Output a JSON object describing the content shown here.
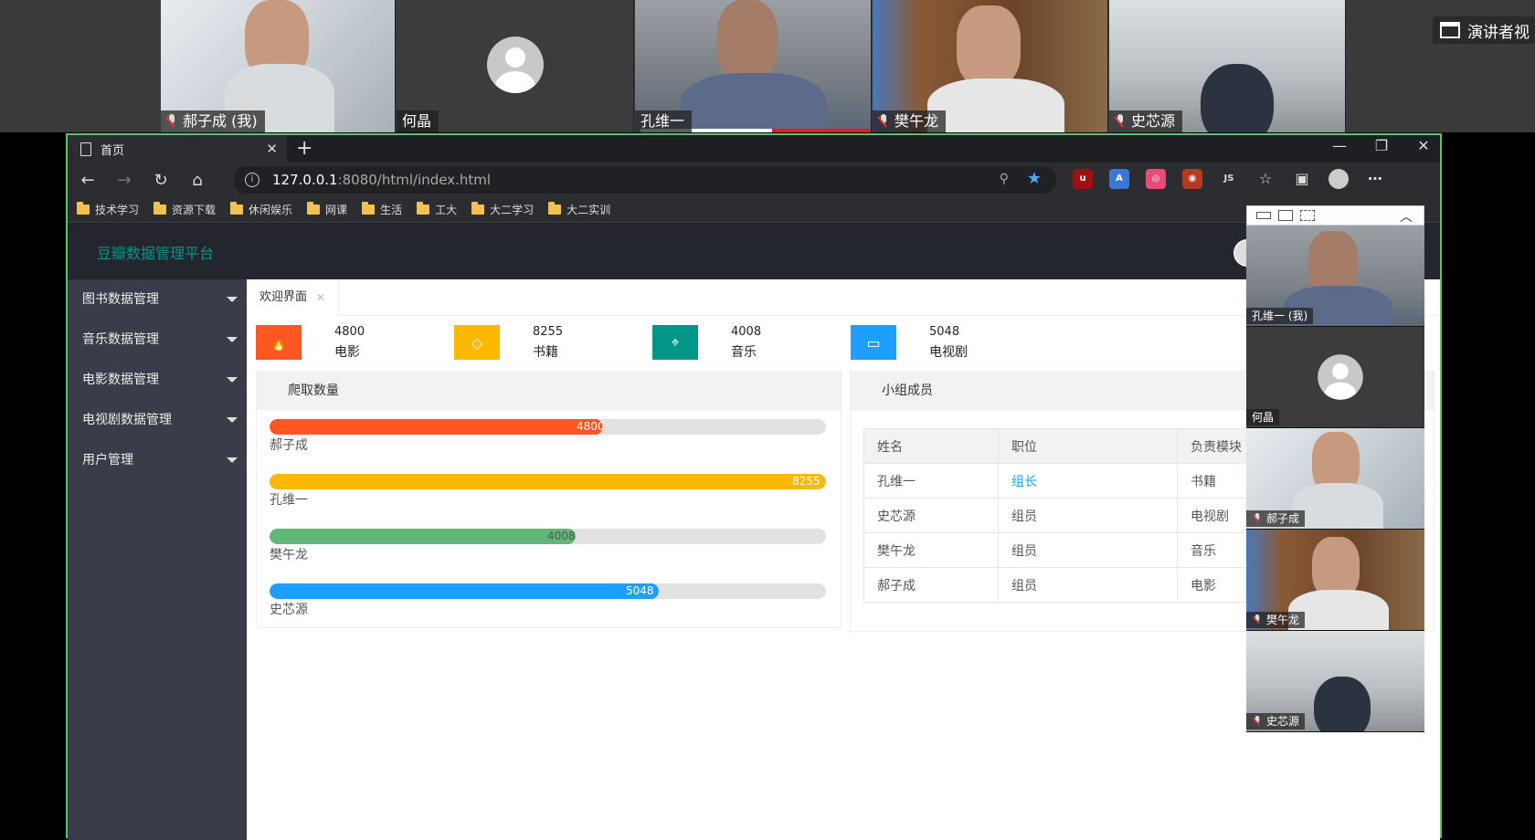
{
  "meeting": {
    "participants": [
      {
        "name": "郝子成 (我)",
        "muted": true
      },
      {
        "name": "何晶",
        "muted": false
      },
      {
        "name": "孔维一",
        "muted": false
      },
      {
        "name": "樊午龙",
        "muted": true
      },
      {
        "name": "史芯源",
        "muted": true
      }
    ],
    "speaker_view_label": "演讲者视",
    "side_participants": [
      {
        "name": "孔维一 (我)"
      },
      {
        "name": "何晶"
      },
      {
        "name": "郝子成"
      },
      {
        "name": "樊午龙"
      },
      {
        "name": "史芯源"
      }
    ]
  },
  "browser": {
    "tab_title": "首页",
    "url_host": "127.0.0.1",
    "url_rest": ":8080/html/index.html",
    "bookmarks": [
      "技术学习",
      "资源下载",
      "休闲娱乐",
      "网课",
      "生活",
      "工大",
      "大二学习",
      "大二实训"
    ]
  },
  "app": {
    "title": "豆瓣数据管理平台",
    "menu": [
      {
        "label": "图书数据管理"
      },
      {
        "label": "音乐数据管理"
      },
      {
        "label": "电影数据管理"
      },
      {
        "label": "电视剧数据管理"
      },
      {
        "label": "用户管理"
      }
    ],
    "tab_label": "欢迎界面",
    "stats": [
      {
        "value": "4800",
        "label": "电影",
        "color": "#ff5722",
        "icon": "fire-icon"
      },
      {
        "value": "8255",
        "label": "书籍",
        "color": "#ffb800",
        "icon": "diamond-icon"
      },
      {
        "value": "4008",
        "label": "音乐",
        "color": "#009688",
        "icon": "location-icon"
      },
      {
        "value": "5048",
        "label": "电视剧",
        "color": "#1e9fff",
        "icon": "tv-icon"
      }
    ],
    "crawl_card": {
      "title": "爬取数量",
      "items": [
        {
          "name": "郝子成",
          "value": "4800",
          "percent": 60,
          "color": "#ff5722"
        },
        {
          "name": "孔维一",
          "value": "8255",
          "percent": 100,
          "color": "#ffb800"
        },
        {
          "name": "樊午龙",
          "value": "4008",
          "percent": 55,
          "color": "#5fb878"
        },
        {
          "name": "史芯源",
          "value": "5048",
          "percent": 70,
          "color": "#1e9fff"
        }
      ]
    },
    "members_card": {
      "title": "小组成员",
      "headers": [
        "姓名",
        "职位",
        "负责模块"
      ],
      "rows": [
        [
          "孔维一",
          "组长",
          "书籍"
        ],
        [
          "史芯源",
          "组员",
          "电视剧"
        ],
        [
          "樊午龙",
          "组员",
          "音乐"
        ],
        [
          "郝子成",
          "组员",
          "电影"
        ]
      ]
    }
  }
}
